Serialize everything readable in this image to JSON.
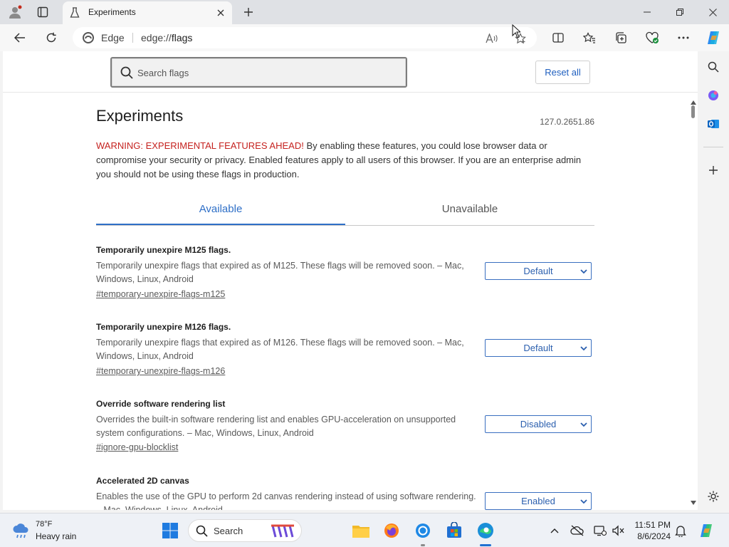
{
  "browser": {
    "tab_title": "Experiments",
    "site_label": "Edge",
    "url_scheme": "edge://",
    "url_path": "flags"
  },
  "search": {
    "placeholder": "Search flags",
    "reset_label": "Reset all"
  },
  "page": {
    "title": "Experiments",
    "version": "127.0.2651.86",
    "warning_prefix": "WARNING: EXPERIMENTAL FEATURES AHEAD!",
    "warning_text": " By enabling these features, you could lose browser data or compromise your security or privacy. Enabled features apply to all users of this browser. If you are an enterprise admin you should not be using these flags in production.",
    "tabs": [
      {
        "label": "Available"
      },
      {
        "label": "Unavailable"
      }
    ],
    "accent_color": "#2e6fc7",
    "warning_color": "#c5221f"
  },
  "flags": [
    {
      "title": "Temporarily unexpire M125 flags.",
      "description": "Temporarily unexpire flags that expired as of M125. These flags will be removed soon. – Mac, Windows, Linux, Android",
      "link": "#temporary-unexpire-flags-m125",
      "value": "Default"
    },
    {
      "title": "Temporarily unexpire M126 flags.",
      "description": "Temporarily unexpire flags that expired as of M126. These flags will be removed soon. – Mac, Windows, Linux, Android",
      "link": "#temporary-unexpire-flags-m126",
      "value": "Default"
    },
    {
      "title": "Override software rendering list",
      "description": "Overrides the built-in software rendering list and enables GPU-acceleration on unsupported system configurations. – Mac, Windows, Linux, Android",
      "link": "#ignore-gpu-blocklist",
      "value": "Disabled"
    },
    {
      "title": "Accelerated 2D canvas",
      "description": "Enables the use of the GPU to perform 2d canvas rendering instead of using software rendering. – Mac, Windows, Linux, Android",
      "link": "",
      "value": "Enabled"
    }
  ],
  "taskbar": {
    "weather_temp": "78°F",
    "weather_desc": "Heavy rain",
    "search_label": "Search",
    "time": "11:51 PM",
    "date": "8/6/2024"
  }
}
